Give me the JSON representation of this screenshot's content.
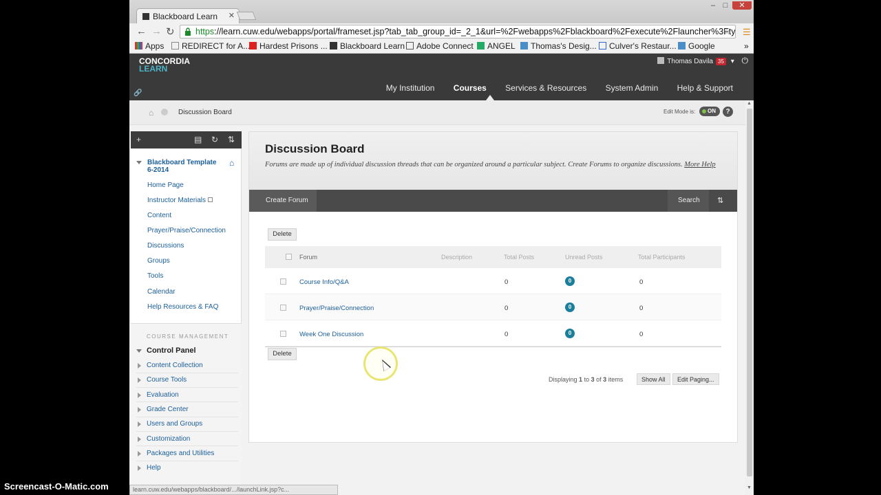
{
  "browser": {
    "tab_title": "Blackboard Learn",
    "url_https": "https",
    "url_rest": "://learn.cuw.edu/webapps/portal/frameset.jsp?tab_tab_group_id=_2_1&url=%2Fwebapps%2Fblackboard%2Fexecute%2Flauncher%3Ftype%",
    "bookmarks": [
      "Apps",
      "REDIRECT for A...",
      "Hardest Prisons ...",
      "Blackboard Learn",
      "Adobe Connect",
      "ANGEL",
      "Thomas's Desig...",
      "Culver's Restaur...",
      "Google"
    ],
    "bookmark_overflow": "»",
    "status_text": "learn.cuw.edu/webapps/blackboard/.../launchLink.jsp?c..."
  },
  "header": {
    "logo_line1": "CONCORDIA",
    "logo_line2": "LEARN",
    "user_name": "Thomas Davila",
    "notification_count": "35",
    "nav": [
      "My Institution",
      "Courses",
      "Services & Resources",
      "System Admin",
      "Help & Support"
    ],
    "active_nav": "Courses"
  },
  "breadcrumb": {
    "current": "Discussion Board",
    "edit_mode_label": "Edit Mode is:",
    "edit_mode_state": "ON"
  },
  "sidebar": {
    "course_title": "Blackboard Template 6-2014",
    "links": [
      "Home Page",
      "Instructor Materials",
      "Content",
      "Prayer/Praise/Connection",
      "Discussions",
      "Groups",
      "Tools",
      "Calendar",
      "Help Resources & FAQ"
    ],
    "management_header": "COURSE MANAGEMENT",
    "control_panel": "Control Panel",
    "management_items": [
      "Content Collection",
      "Course Tools",
      "Evaluation",
      "Grade Center",
      "Users and Groups",
      "Customization",
      "Packages and Utilities",
      "Help"
    ]
  },
  "main": {
    "title": "Discussion Board",
    "description": "Forums are made up of individual discussion threads that can be organized around a particular subject. Create Forums to organize discussions.",
    "more_help": "More Help",
    "create_forum": "Create Forum",
    "search": "Search",
    "delete_label": "Delete",
    "columns": [
      "Forum",
      "Description",
      "Total Posts",
      "Unread Posts",
      "Total Participants"
    ],
    "rows": [
      {
        "forum": "Course Info/Q&A",
        "total_posts": "0",
        "unread": "0",
        "participants": "0"
      },
      {
        "forum": "Prayer/Praise/Connection",
        "total_posts": "0",
        "unread": "0",
        "participants": "0"
      },
      {
        "forum": "Week One Discussion",
        "total_posts": "0",
        "unread": "0",
        "participants": "0"
      }
    ],
    "paging_prefix": "Displaying",
    "paging_from": "1",
    "paging_to": "3",
    "paging_total": "3",
    "paging_mid": "to",
    "paging_of": "of",
    "paging_suffix": "items",
    "show_all": "Show All",
    "edit_paging": "Edit Paging..."
  },
  "overlay": {
    "watermark": "Screencast-O-Matic.com"
  },
  "colors": {
    "link": "#1a5e9b",
    "header_bg": "#3a3a3a",
    "unread_badge": "#1b7f9c",
    "notification_badge": "#c3262f"
  }
}
